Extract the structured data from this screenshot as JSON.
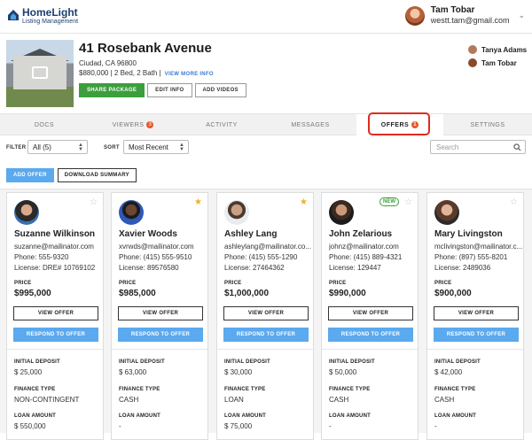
{
  "app": {
    "logo_name": "HomeLight",
    "logo_sub": "Listing Management"
  },
  "user": {
    "name": "Tam Tobar",
    "email": "westt.tam@gmail.com"
  },
  "property": {
    "address": "41 Rosebank Avenue",
    "city": "Ciudad, CA 96800",
    "summary": "$880,000 | 2 Bed, 2 Bath |",
    "view_more": "VIEW MORE INFO",
    "buttons": {
      "share": "SHARE PACKAGE",
      "edit": "EDIT INFO",
      "videos": "ADD VIDEOS"
    },
    "agents": [
      "Tanya Adams",
      "Tam Tobar"
    ]
  },
  "tabs": [
    {
      "label": "DOCS"
    },
    {
      "label": "VIEWERS",
      "badge": "3"
    },
    {
      "label": "ACTIVITY"
    },
    {
      "label": "MESSAGES"
    },
    {
      "label": "OFFERS",
      "badge": "1",
      "active": true
    },
    {
      "label": "SETTINGS"
    }
  ],
  "filters": {
    "filter_label": "FILTER",
    "filter_value": "All (5)",
    "sort_label": "SORT",
    "sort_value": "Most Recent",
    "search_placeholder": "Search"
  },
  "actions": {
    "add_offer": "ADD OFFER",
    "download": "DOWNLOAD SUMMARY"
  },
  "labels": {
    "price": "PRICE",
    "view_offer": "VIEW OFFER",
    "respond": "RESPOND TO OFFER",
    "deposit": "INITIAL DEPOSIT",
    "finance": "FINANCE TYPE",
    "loan": "LOAN AMOUNT",
    "new": "NEW"
  },
  "offers": [
    {
      "name": "Suzanne Wilkinson",
      "email": "suzanne@mailinator.com",
      "phone": "Phone: 555-9320",
      "license": "License: DRE# 10769102",
      "price": "$995,000",
      "deposit": "$ 25,000",
      "finance": "NON-CONTINGENT",
      "loan": "$ 550,000",
      "starred": false,
      "is_new": false
    },
    {
      "name": "Xavier Woods",
      "email": "xvrwds@mailinator.com",
      "phone": "Phone: (415) 555-9510",
      "license": "License: 89576580",
      "price": "$985,000",
      "deposit": "$ 63,000",
      "finance": "CASH",
      "loan": "-",
      "starred": true,
      "is_new": false
    },
    {
      "name": "Ashley Lang",
      "email": "ashleylang@mailinator.co...",
      "phone": "Phone: (415) 555-1290",
      "license": "License: 27464362",
      "price": "$1,000,000",
      "deposit": "$ 30,000",
      "finance": "LOAN",
      "loan": "$ 75,000",
      "starred": true,
      "is_new": false
    },
    {
      "name": "John Zelarious",
      "email": "johnz@mailinator.com",
      "phone": "Phone: (415) 889-4321",
      "license": "License: 129447",
      "price": "$990,000",
      "deposit": "$ 50,000",
      "finance": "CASH",
      "loan": "-",
      "starred": false,
      "is_new": true
    },
    {
      "name": "Mary Livingston",
      "email": "mclivingston@mailinator.c...",
      "phone": "Phone: (897) 555-8201",
      "license": "License: 2489036",
      "price": "$900,000",
      "deposit": "$ 42,000",
      "finance": "CASH",
      "loan": "-",
      "starred": false,
      "is_new": false
    }
  ]
}
